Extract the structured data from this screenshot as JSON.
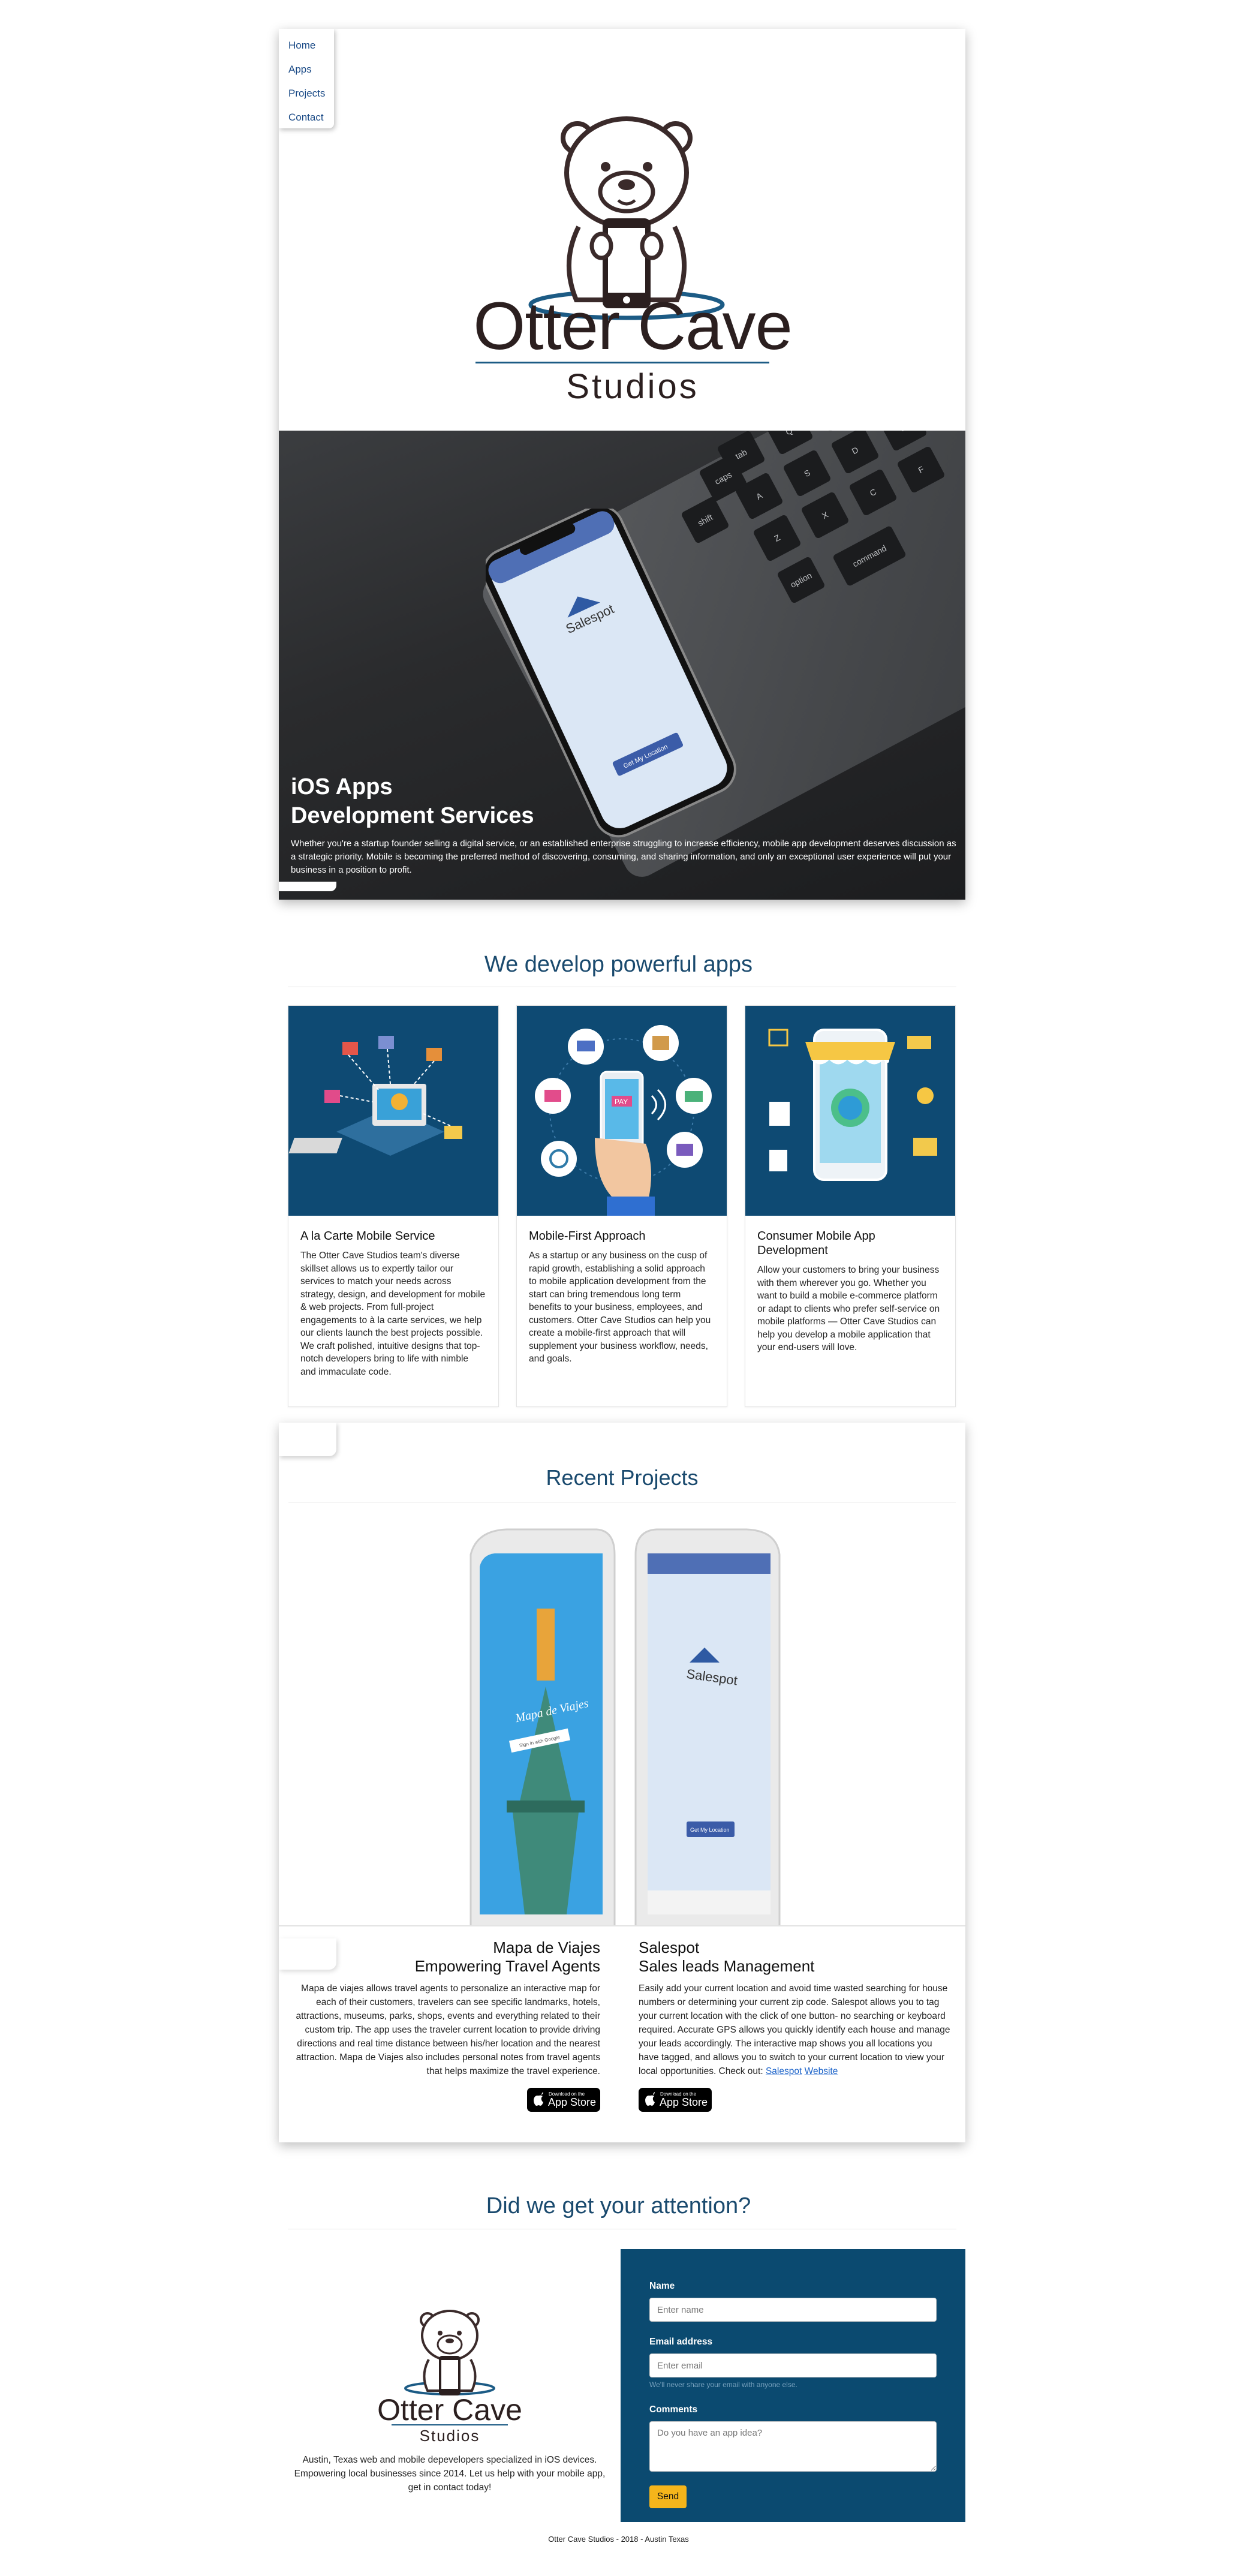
{
  "nav": {
    "items": [
      "Home",
      "Apps",
      "Projects",
      "Contact"
    ]
  },
  "logo": {
    "title": "Otter Cave",
    "subtitle": "Studios"
  },
  "hero": {
    "title_line1": "iOS Apps",
    "title_line2": "Development Services",
    "text": "Whether you're a startup founder selling a digital service, or an established enterprise struggling to increase efficiency, mobile app development deserves discussion as a strategic priority. Mobile is becoming the preferred method of discovering, consuming, and sharing information, and only an exceptional user experience will put your business in a position to profit.",
    "phone_app_name": "Salespot",
    "phone_button": "Get My Location"
  },
  "services": {
    "title": "We develop powerful apps",
    "cards": [
      {
        "title": "A la Carte Mobile Service",
        "text": "The Otter Cave Studios team's diverse skillset allows us to expertly tailor our services to match your needs across strategy, design, and development for mobile & web projects. From full-project engagements to à la carte services, we help our clients launch the best projects possible. We craft polished, intuitive designs that top-notch developers bring to life with nimble and immaculate code."
      },
      {
        "title": "Mobile-First Approach",
        "text": "As a startup or any business on the cusp of rapid growth, establishing a solid approach to mobile application development from the start can bring tremendous long term benefits to your business, employees, and customers. Otter Cave Studios can help you create a mobile-first approach that will supplement your business workflow, needs, and goals."
      },
      {
        "title": "Consumer Mobile App Development",
        "text": "Allow your customers to bring your business with them wherever you go. Whether you want to build a mobile e-commerce platform or adapt to clients who prefer self-service on mobile platforms — Otter Cave Studios can help you develop a mobile application that your end-users will love."
      }
    ],
    "pay_label": "PAY"
  },
  "projects": {
    "title": "Recent Projects",
    "phone1_app": "Mapa de Viajes",
    "phone1_search": "Sign in with Google",
    "phone2_app": "Salespot",
    "phone2_button": "Get My Location",
    "left": {
      "title_line1": "Mapa de Viajes",
      "title_line2": "Empowering Travel Agents",
      "text": "Mapa de viajes allows travel agents to personalize an interactive map for each of their customers, travelers can see specific landmarks, hotels, attractions, museums, parks, shops, events and everything related to their custom trip. The app uses the traveler current location to provide driving directions and real time distance between his/her location and the nearest attraction. Mapa de Viajes also includes personal notes from travel agents that helps maximize the travel experience."
    },
    "right": {
      "title_line1": "Salespot",
      "title_line2": "Sales leads Management",
      "text": "Easily add your current location and avoid time wasted searching for house numbers or determining your current zip code. Salespot allows you to tag your current location with the click of one button- no searching or keyboard required. Accurate GPS allows you quickly identify each house and manage your leads accordingly. The interactive map shows you all locations you have tagged, and allows you to switch to your current location to view your local opportunities. Check out:",
      "link1": "Salespot",
      "link2": "Website"
    },
    "appstore_small": "Download on the",
    "appstore_big": "App Store"
  },
  "contact": {
    "title": "Did we get your attention?",
    "logo_title": "Otter Cave",
    "logo_subtitle": "Studios",
    "text": "Austin, Texas web and mobile depevelopers specialized in iOS devices. Empowering local businesses since 2014. Let us help with your mobile app, get in contact today!",
    "name_label": "Name",
    "name_placeholder": "Enter name",
    "email_label": "Email address",
    "email_placeholder": "Enter email",
    "email_help": "We'll never share your email with anyone else.",
    "comments_label": "Comments",
    "comments_placeholder": "Do you have an app idea?",
    "send": "Send"
  },
  "footer": {
    "text": "Otter Cave Studios - 2018 - Austin Texas"
  },
  "colors": {
    "brand_blue": "#0b4a70",
    "title_blue": "#1a4a6e",
    "send_yellow": "#f5b51b"
  }
}
